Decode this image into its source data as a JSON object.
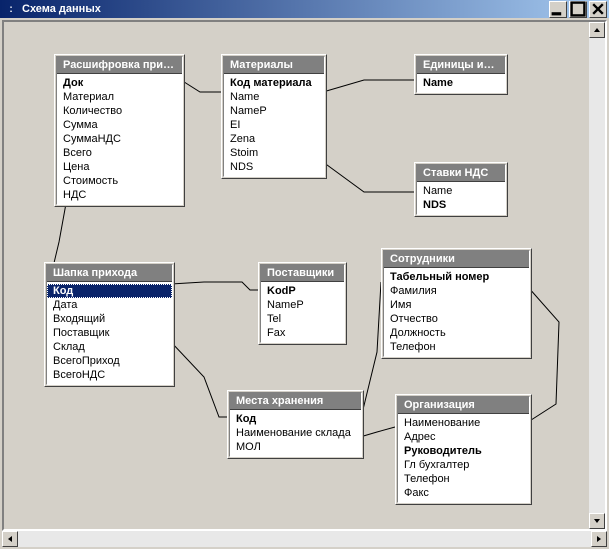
{
  "window": {
    "title": "Схема данных"
  },
  "tables": {
    "rasshifrovka": {
      "title": "Расшифровка прихо…",
      "fields": [
        {
          "label": "Док",
          "bold": true
        },
        {
          "label": "Материал"
        },
        {
          "label": "Количество"
        },
        {
          "label": "Сумма"
        },
        {
          "label": "СуммаНДС"
        },
        {
          "label": "Всего"
        },
        {
          "label": "Цена"
        },
        {
          "label": "Стоимость"
        },
        {
          "label": "НДС"
        }
      ]
    },
    "materialy": {
      "title": "Материалы",
      "fields": [
        {
          "label": "Код материала",
          "bold": true
        },
        {
          "label": "Name"
        },
        {
          "label": "NameP"
        },
        {
          "label": "EI"
        },
        {
          "label": "Zena"
        },
        {
          "label": "Stoim"
        },
        {
          "label": "NDS"
        }
      ]
    },
    "edinicy": {
      "title": "Единицы изм…",
      "fields": [
        {
          "label": "Name",
          "bold": true
        }
      ]
    },
    "stavki_nds": {
      "title": "Ставки НДС",
      "fields": [
        {
          "label": "Name"
        },
        {
          "label": "NDS",
          "bold": true
        }
      ]
    },
    "shapka_prihoda": {
      "title": "Шапка прихода",
      "fields": [
        {
          "label": "Код",
          "bold": true,
          "selected": true
        },
        {
          "label": "Дата"
        },
        {
          "label": "Входящий"
        },
        {
          "label": "Поставщик"
        },
        {
          "label": "Склад"
        },
        {
          "label": "ВсегоПриход"
        },
        {
          "label": "ВсегоНДС"
        }
      ]
    },
    "postavshchiki": {
      "title": "Поставщики",
      "fields": [
        {
          "label": "KodP",
          "bold": true
        },
        {
          "label": "NameP"
        },
        {
          "label": "Tel"
        },
        {
          "label": "Fax"
        }
      ]
    },
    "sotrudniki": {
      "title": "Сотрудники",
      "fields": [
        {
          "label": "Табельный номер",
          "bold": true
        },
        {
          "label": "Фамилия"
        },
        {
          "label": "Имя"
        },
        {
          "label": "Отчество"
        },
        {
          "label": "Должность"
        },
        {
          "label": "Телефон"
        }
      ]
    },
    "mesta_hraneniya": {
      "title": "Места хранения",
      "fields": [
        {
          "label": "Код",
          "bold": true
        },
        {
          "label": "Наименование склада"
        },
        {
          "label": "МОЛ"
        }
      ]
    },
    "organizaciya": {
      "title": "Организация",
      "fields": [
        {
          "label": "Наименование"
        },
        {
          "label": "Адрес"
        },
        {
          "label": "Руководитель",
          "bold": true
        },
        {
          "label": "Гл бухгалтер"
        },
        {
          "label": "Телефон"
        },
        {
          "label": "Факс"
        }
      ]
    }
  }
}
